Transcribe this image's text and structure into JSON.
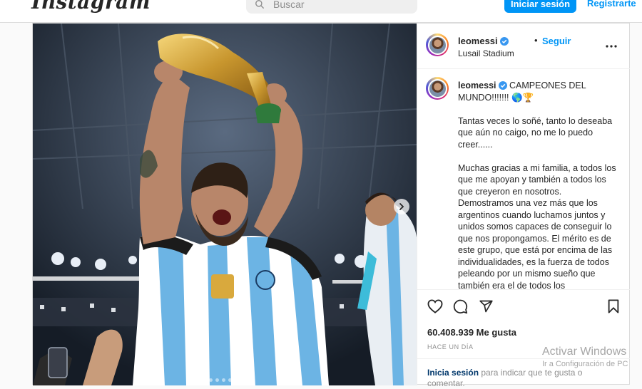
{
  "nav": {
    "logo_text": "Instagram",
    "search_placeholder": "Buscar",
    "login_label": "Iniciar sesión",
    "signup_label": "Registrarte"
  },
  "post": {
    "username": "leomessi",
    "follow_label": "Seguir",
    "separator": "•",
    "location": "Lusail Stadium",
    "caption": {
      "username": "leomessi",
      "headline": " CAMPEONES DEL MUNDO!!!!!!! 🌎🏆",
      "paragraph_1": "Tantas veces lo soñé, tanto lo deseaba que aún no caigo, no me lo puedo creer......",
      "paragraph_2": "Muchas gracias a mi familia, a todos los que me apoyan y también a todos los que creyeron en nosotros. Demostramos una vez más que los argentinos cuando luchamos juntos y unidos somos capaces de conseguir lo que nos propongamos. El mérito es de este grupo, que está por encima de las individualidades, es la fuerza de todos peleando por un mismo sueño que también era el de todos los"
    },
    "likes_text": "60.408.939 Me gusta",
    "time_text": "HACE UN DÍA",
    "login_prompt": {
      "link": "Inicia sesión",
      "rest": " para indicar que te gusta o comentar."
    },
    "carousel_index": 1,
    "carousel_total": 10
  },
  "watermark": {
    "title": "Activar Windows",
    "subtitle": "Ir a Configuración de PC"
  },
  "colors": {
    "accent": "#0095f6",
    "border": "#dbdbdb",
    "verified": "#3897f0",
    "shirt_stripe": "#6cb4e4"
  },
  "icons": [
    "search-icon",
    "verified-icon",
    "more-options-icon",
    "heart-icon",
    "comment-icon",
    "share-icon",
    "bookmark-icon",
    "chevron-right-icon"
  ]
}
